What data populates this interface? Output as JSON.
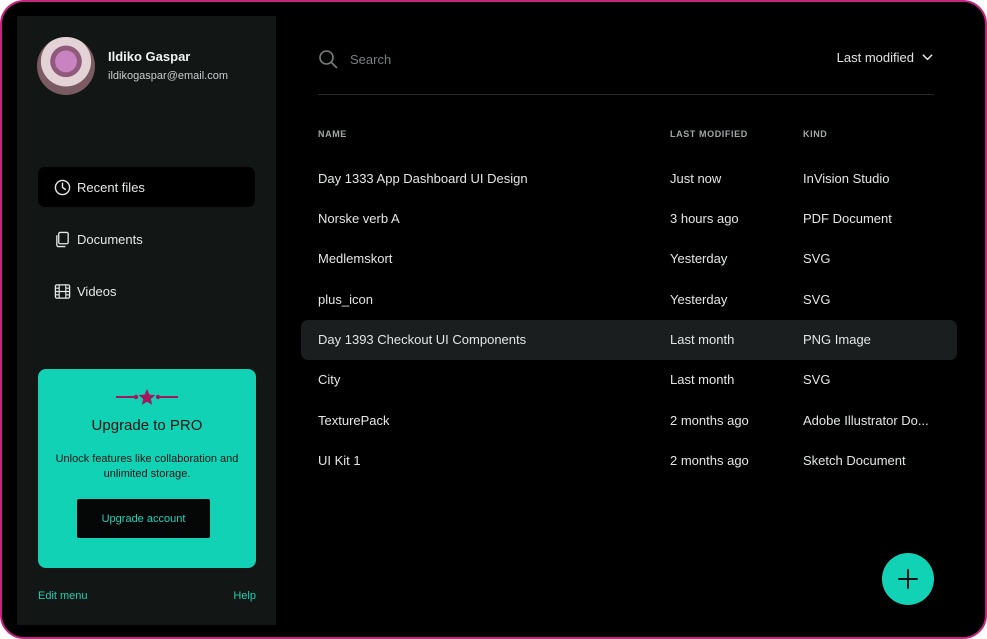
{
  "user": {
    "name": "Ildiko Gaspar",
    "email": "ildikogaspar@email.com"
  },
  "nav": [
    {
      "label": "Recent files",
      "icon": "clock-icon",
      "active": true
    },
    {
      "label": "Documents",
      "icon": "documents-icon",
      "active": false
    },
    {
      "label": "Videos",
      "icon": "film-icon",
      "active": false
    }
  ],
  "promo": {
    "title": "Upgrade to PRO",
    "text": "Unlock features like collaboration and unlimited storage.",
    "button_label": "Upgrade account"
  },
  "footer": {
    "edit_menu": "Edit menu",
    "help": "Help"
  },
  "search": {
    "placeholder": "Search"
  },
  "sort": {
    "label": "Last modified"
  },
  "table": {
    "headers": {
      "name": "NAME",
      "last_modified": "LAST MODIFIED",
      "kind": "KIND"
    },
    "rows": [
      {
        "name": "Day 1333 App Dashboard UI Design",
        "last_modified": "Just now",
        "kind": "InVision Studio"
      },
      {
        "name": "Norske verb A",
        "last_modified": "3 hours ago",
        "kind": "PDF Document"
      },
      {
        "name": "Medlemskort",
        "last_modified": "Yesterday",
        "kind": "SVG"
      },
      {
        "name": "plus_icon",
        "last_modified": "Yesterday",
        "kind": "SVG"
      },
      {
        "name": "Day 1393 Checkout UI Components",
        "last_modified": "Last month",
        "kind": "PNG Image",
        "highlighted": true
      },
      {
        "name": "City",
        "last_modified": "Last month",
        "kind": "SVG"
      },
      {
        "name": "TexturePack",
        "last_modified": "2 months ago",
        "kind": "Adobe Illustrator Do..."
      },
      {
        "name": "UI Kit 1",
        "last_modified": "2 months ago",
        "kind": "Sketch Document"
      }
    ]
  },
  "colors": {
    "accent": "#12d2b6",
    "frame_border": "#c2267e",
    "promo_decor": "#a1185c"
  }
}
